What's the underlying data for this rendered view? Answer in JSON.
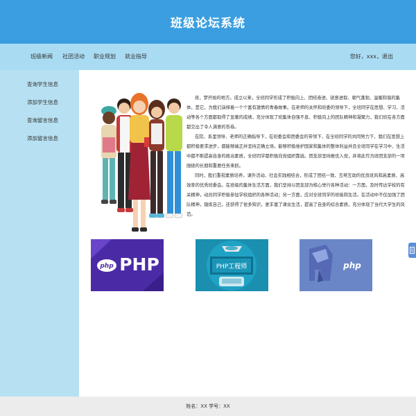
{
  "header": {
    "title": "班级论坛系统"
  },
  "nav": {
    "items": [
      "班级新闻",
      "社团活动",
      "职业规划",
      "就业指导"
    ],
    "user_info": "您好，xxx，退出"
  },
  "sidebar": {
    "items": [
      "查询学生信息",
      "添加学生信息",
      "查询留言信息",
      "添加留言信息"
    ]
  },
  "main": {
    "paragraphs": [
      "班，梦开始的地方。成立以来，全班同学形成了积极向上、团结奋进、锐意进取、朝气蓬勃、温暖和谐的集体。是它，为我们演绎着一个个富有激情的青春故事。在老师的关怀和班委的领导下，全班同学在思想、学习、活动等各个方面都取得了显著的成绩，充分体现了班集体自强不息、积极向上的团队精神和凝聚力，我们班在各方面都交出了令人满意的答卷。",
      "在院、系里领导、老师的正确指导下，在班委会和团委会的带领下，在全班同学的共同努力下，我们在思想上都积极要求进步，都能够端正并坚持正确立场，能够积极维护国家和集体的整体利益并且全班同学在学习中、生活中都不断提高自身的政治素质，全班同学都积极向党组织靠拢。团支部坚持推优入党，并将此作为班团支部的一项围绕的长期和重要任务来抓。",
      "同时，我们重视素质培养，课外活动、社会实践相结合，形成了团结一致、互帮互助的优良班风和高素质、高效率的优秀班委会。在班级的集体生活方面，我们坚持以团支部为核心举行各种活动：一方面，及时传达学校的有关精神，动员同学积极参加学校组织的各种活动；另一方面，应对全班同学的班级和生活。在活动中不仅加强了团队精神，锻炼自己，还获得了很多知识，更丰富了课余生活，提高了自身的综合素质，充分体现了当代大学生的风范。"
    ],
    "tiles": [
      {
        "label": "php PHP"
      },
      {
        "label": "PHP工程师"
      },
      {
        "label": "php"
      }
    ]
  },
  "footer": {
    "text": "姓名：XX 学号：XX"
  }
}
